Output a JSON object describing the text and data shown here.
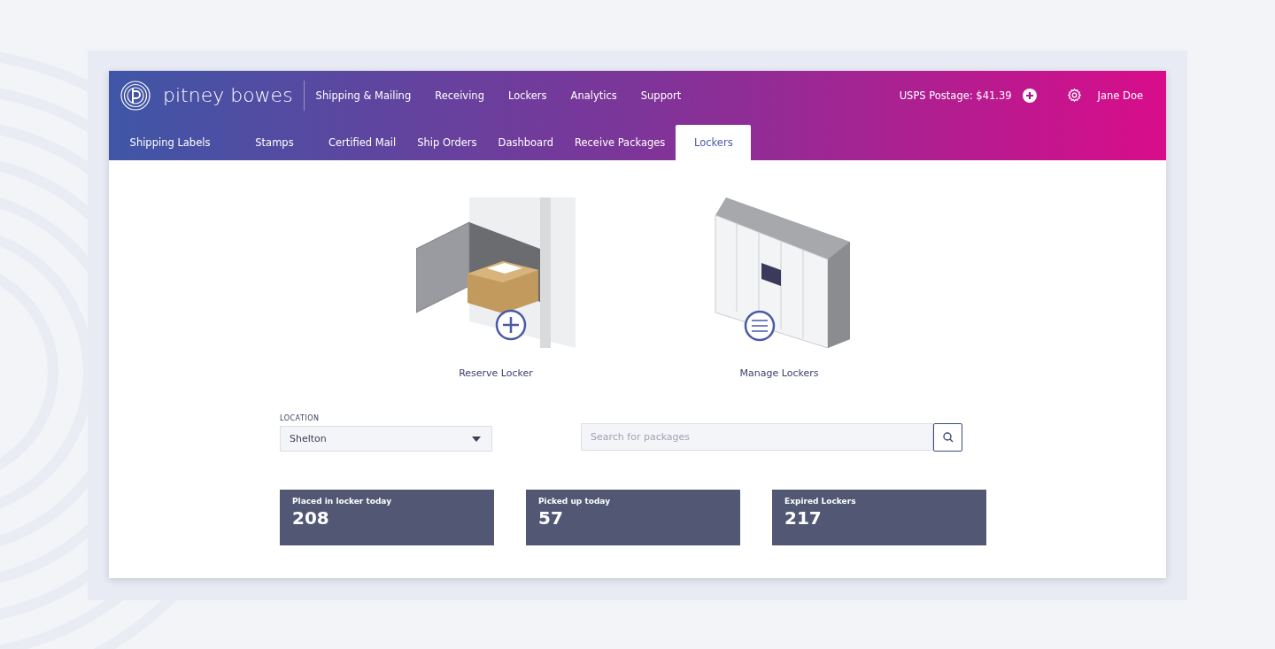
{
  "brand": {
    "name": "pitney bowes"
  },
  "nav": [
    {
      "label": "Shipping & Mailing"
    },
    {
      "label": "Receiving"
    },
    {
      "label": "Lockers"
    },
    {
      "label": "Analytics"
    },
    {
      "label": "Support"
    }
  ],
  "account": {
    "postage": "USPS Postage: $41.39",
    "user": "Jane Doe"
  },
  "tabs": [
    {
      "label": "Shipping Labels",
      "selected": false
    },
    {
      "label": "Stamps",
      "selected": false
    },
    {
      "label": "Certified Mail",
      "selected": false
    },
    {
      "label": "Ship Orders",
      "selected": false
    },
    {
      "label": "Dashboard",
      "selected": false
    },
    {
      "label": "Receive Packages",
      "selected": false
    },
    {
      "label": "Lockers",
      "selected": true
    }
  ],
  "actions": [
    {
      "kind": "reserve",
      "label": "Reserve Locker"
    },
    {
      "kind": "manage",
      "label": "Manage Lockers"
    }
  ],
  "location": {
    "label": "LOCATION",
    "value": "Shelton"
  },
  "search": {
    "placeholder": "Search for packages"
  },
  "stats": [
    {
      "label": "Placed in locker today",
      "value": "208"
    },
    {
      "label": "Picked up today",
      "value": "57"
    },
    {
      "label": "Expired Lockers",
      "value": "217"
    }
  ]
}
